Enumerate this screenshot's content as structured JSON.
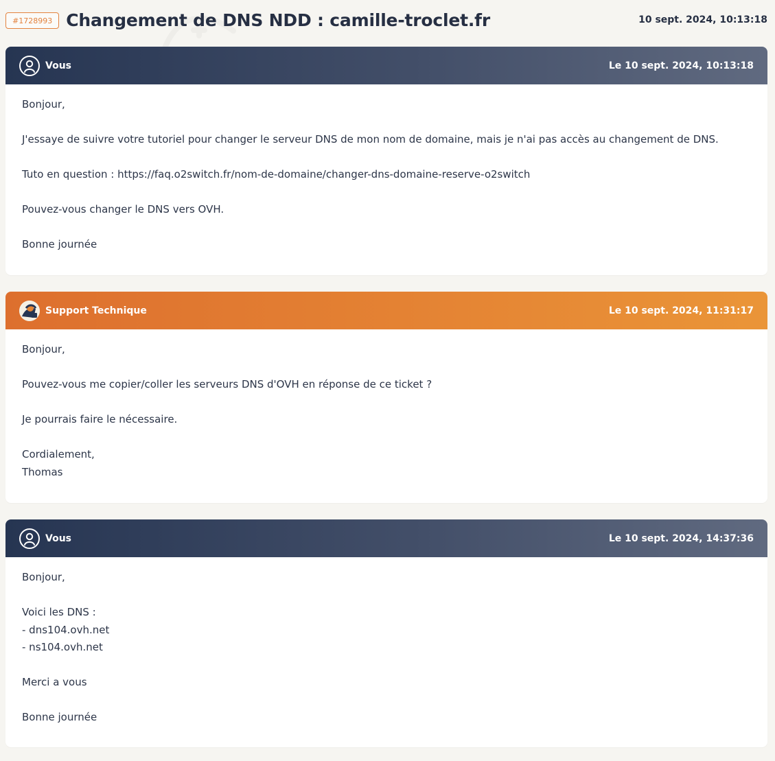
{
  "ticket": {
    "badge": "#1728993",
    "title": "Changement de DNS NDD : camille-troclet.fr",
    "date": "10 sept. 2024, 10:13:18"
  },
  "colors": {
    "accent": "#e3823e",
    "user_header": "#263552",
    "support_header": "#dd6f2e",
    "page_background": "#f6f5f1"
  },
  "messages": [
    {
      "sender": "Vous",
      "avatar_icon": "user-circle-icon",
      "date": "Le 10 sept. 2024, 10:13:18",
      "lines": [
        "Bonjour,",
        "",
        "J'essaye de suivre votre tutoriel pour changer le serveur DNS de mon nom de domaine, mais je n'ai pas accès au changement de DNS.",
        "",
        "Tuto en question : https://faq.o2switch.fr/nom-de-domaine/changer-dns-domaine-reserve-o2switch",
        "",
        "Pouvez-vous changer le DNS vers OVH.",
        "",
        "Bonne journée"
      ]
    },
    {
      "sender": "Support Technique",
      "avatar_icon": "support-avatar-icon",
      "date": "Le 10 sept. 2024, 11:31:17",
      "lines": [
        "Bonjour,",
        "",
        "Pouvez-vous me copier/coller les serveurs DNS d'OVH en réponse de ce ticket ?",
        "",
        "Je pourrais faire le nécessaire.",
        "",
        "Cordialement,",
        "Thomas"
      ]
    },
    {
      "sender": "Vous",
      "avatar_icon": "user-circle-icon",
      "date": "Le 10 sept. 2024, 14:37:36",
      "lines": [
        "Bonjour,",
        "",
        "Voici les DNS :",
        "- dns104.ovh.net",
        "- ns104.ovh.net",
        "",
        "Merci a vous",
        "",
        "Bonne journée"
      ]
    }
  ]
}
